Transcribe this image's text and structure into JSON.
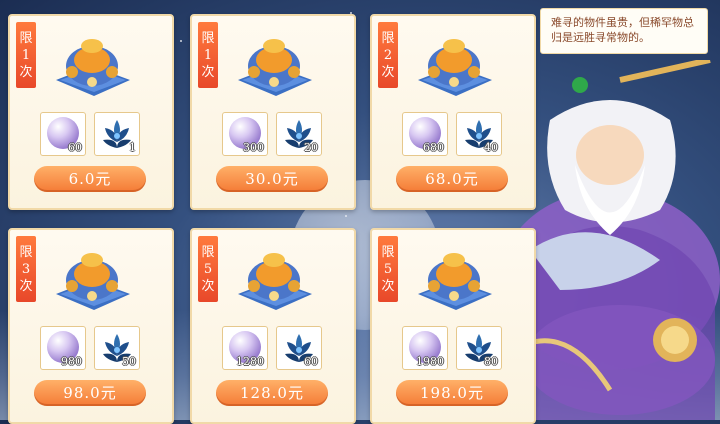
{
  "tip_text": "难寻的物件虽贵，但稀罕物总归是远胜寻常物的。",
  "packs": [
    {
      "limit": [
        "限",
        "1",
        "次"
      ],
      "pearl_qty": "60",
      "lotus_qty": "1",
      "price": "6.0元"
    },
    {
      "limit": [
        "限",
        "1",
        "次"
      ],
      "pearl_qty": "300",
      "lotus_qty": "20",
      "price": "30.0元"
    },
    {
      "limit": [
        "限",
        "2",
        "次"
      ],
      "pearl_qty": "680",
      "lotus_qty": "40",
      "price": "68.0元"
    },
    {
      "limit": [
        "限",
        "3",
        "次"
      ],
      "pearl_qty": "980",
      "lotus_qty": "50",
      "price": "98.0元"
    },
    {
      "limit": [
        "限",
        "5",
        "次"
      ],
      "pearl_qty": "1280",
      "lotus_qty": "60",
      "price": "128.0元"
    },
    {
      "limit": [
        "限",
        "5",
        "次"
      ],
      "pearl_qty": "1980",
      "lotus_qty": "80",
      "price": "198.0元"
    }
  ],
  "colors": {
    "tag": "#e8482a",
    "button": "#f47a35",
    "card_border": "#f1d9a8",
    "tip_text": "#8a4a2c"
  },
  "icons": {
    "pack": "treasure-bag-icon",
    "currency": "pearl-icon",
    "item": "blue-lotus-icon"
  }
}
